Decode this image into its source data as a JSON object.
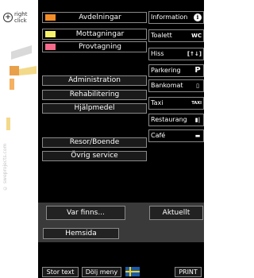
{
  "zoom_hint": {
    "symbol": "+",
    "line1": "right",
    "line2": "click"
  },
  "side_credit": "© sweprojects.com",
  "categories": [
    {
      "label": "Avdelningar",
      "color": "#f28c28"
    },
    {
      "label": "Mottagningar",
      "color": "#f7f26a"
    },
    {
      "label": "Provtagning",
      "color": "#f46a8a"
    }
  ],
  "menu": {
    "administration": "Administration",
    "rehabilitering": "Rehabilitering",
    "hjalpmedel": "Hjälpmedel",
    "resor": "Resor/Boende",
    "ovrig": "Övrig service"
  },
  "services": [
    {
      "label": "Information",
      "icon": "i"
    },
    {
      "label": "Toalett",
      "icon": "WC"
    },
    {
      "label": "Hiss",
      "icon": "[↑↓]"
    },
    {
      "label": "Parkering",
      "icon": "P"
    },
    {
      "label": "Bankomat",
      "icon": "▯"
    },
    {
      "label": "Taxi",
      "icon": "TAXI"
    },
    {
      "label": "Restaurang",
      "icon": "▮|"
    },
    {
      "label": "Café",
      "icon": "▬"
    }
  ],
  "bottom": {
    "var_finns": "Var finns...",
    "aktuellt": "Aktuellt",
    "hemsida": "Hemsida"
  },
  "footer": {
    "stor_text": "Stor text",
    "dolj_meny": "Dölj meny",
    "print": "PRINT"
  }
}
